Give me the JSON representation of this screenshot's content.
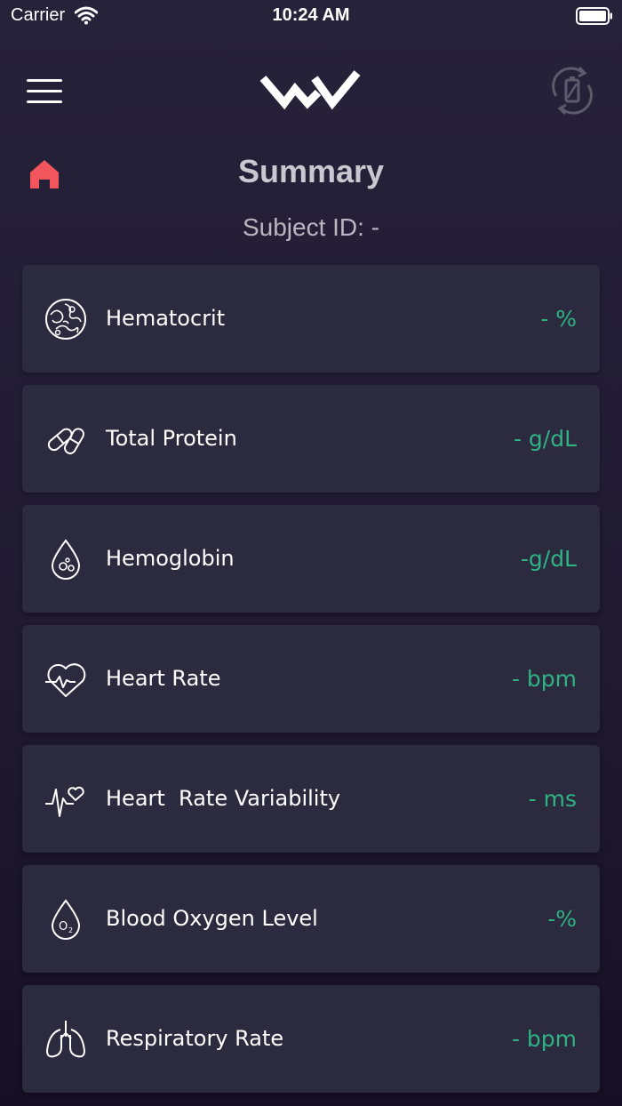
{
  "status_bar": {
    "carrier": "Carrier",
    "time": "10:24 AM"
  },
  "header": {
    "title": "Summary",
    "subject_label": "Subject ID: -"
  },
  "colors": {
    "background": "#231e35",
    "card": "#2c2a3f",
    "value_accent": "#2fb383",
    "home_icon": "#f2555b"
  },
  "metrics": [
    {
      "label": "Hematocrit",
      "value": "- %",
      "icon": "blood-cells-icon"
    },
    {
      "label": "Total Protein",
      "value": "- g/dL",
      "icon": "protein-capsule-icon"
    },
    {
      "label": "Hemoglobin",
      "value": "-g/dL",
      "icon": "blood-drop-icon"
    },
    {
      "label": "Heart Rate",
      "value": "- bpm",
      "icon": "heart-pulse-icon"
    },
    {
      "label": "Heart  Rate Variability",
      "value": "- ms",
      "icon": "ecg-heart-icon"
    },
    {
      "label": "Blood Oxygen Level",
      "value": "-%",
      "icon": "oxygen-drop-icon"
    },
    {
      "label": "Respiratory Rate",
      "value": "- bpm",
      "icon": "lungs-icon"
    }
  ]
}
